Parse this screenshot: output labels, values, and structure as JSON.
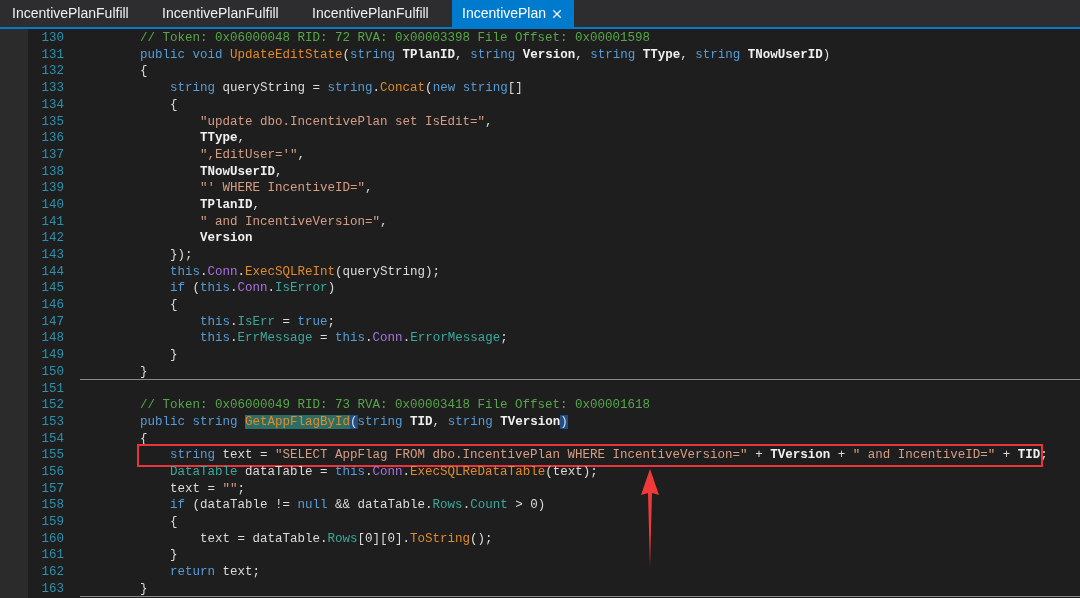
{
  "tabs": [
    {
      "label": "IncentivePlanFulfill",
      "selected": false
    },
    {
      "label": "IncentivePlanFulfill",
      "selected": false
    },
    {
      "label": "IncentivePlanFulfill",
      "selected": false
    },
    {
      "label": "IncentivePlan",
      "selected": true
    }
  ],
  "lines": [
    {
      "number": "130",
      "tokens": [
        {
          "kind": "comment",
          "text": "        // Token: 0x06000048 RID: 72 RVA: 0x00003398 File Offset: 0x00001598"
        }
      ]
    },
    {
      "number": "131",
      "tokens": [
        {
          "kind": "keyword",
          "text": "        public void "
        },
        {
          "kind": "method",
          "text": "UpdateEditState"
        },
        {
          "kind": "plain",
          "text": "("
        },
        {
          "kind": "keyword",
          "text": "string "
        },
        {
          "kind": "param",
          "text": "TPlanID"
        },
        {
          "kind": "plain",
          "text": ", "
        },
        {
          "kind": "keyword",
          "text": "string "
        },
        {
          "kind": "param",
          "text": "Version"
        },
        {
          "kind": "plain",
          "text": ", "
        },
        {
          "kind": "keyword",
          "text": "string "
        },
        {
          "kind": "param",
          "text": "TType"
        },
        {
          "kind": "plain",
          "text": ", "
        },
        {
          "kind": "keyword",
          "text": "string "
        },
        {
          "kind": "param",
          "text": "TNowUserID"
        },
        {
          "kind": "plain",
          "text": ")"
        }
      ]
    },
    {
      "number": "132",
      "tokens": [
        {
          "kind": "plain",
          "text": "        {"
        }
      ]
    },
    {
      "number": "133",
      "tokens": [
        {
          "kind": "keyword",
          "text": "            string "
        },
        {
          "kind": "plain",
          "text": "queryString = "
        },
        {
          "kind": "keyword",
          "text": "string"
        },
        {
          "kind": "plain",
          "text": "."
        },
        {
          "kind": "method",
          "text": "Concat"
        },
        {
          "kind": "plain",
          "text": "("
        },
        {
          "kind": "keyword",
          "text": "new string"
        },
        {
          "kind": "plain",
          "text": "[]"
        }
      ]
    },
    {
      "number": "134",
      "tokens": [
        {
          "kind": "plain",
          "text": "            {"
        }
      ]
    },
    {
      "number": "135",
      "tokens": [
        {
          "kind": "string",
          "text": "                \"update dbo.IncentivePlan set IsEdit=\""
        },
        {
          "kind": "plain",
          "text": ","
        }
      ]
    },
    {
      "number": "136",
      "tokens": [
        {
          "kind": "param",
          "text": "                TType"
        },
        {
          "kind": "plain",
          "text": ","
        }
      ]
    },
    {
      "number": "137",
      "tokens": [
        {
          "kind": "string",
          "text": "                \",EditUser='\""
        },
        {
          "kind": "plain",
          "text": ","
        }
      ]
    },
    {
      "number": "138",
      "tokens": [
        {
          "kind": "param",
          "text": "                TNowUserID"
        },
        {
          "kind": "plain",
          "text": ","
        }
      ]
    },
    {
      "number": "139",
      "tokens": [
        {
          "kind": "string",
          "text": "                \"' WHERE IncentiveID=\""
        },
        {
          "kind": "plain",
          "text": ","
        }
      ]
    },
    {
      "number": "140",
      "tokens": [
        {
          "kind": "param",
          "text": "                TPlanID"
        },
        {
          "kind": "plain",
          "text": ","
        }
      ]
    },
    {
      "number": "141",
      "tokens": [
        {
          "kind": "string",
          "text": "                \" and IncentiveVersion=\""
        },
        {
          "kind": "plain",
          "text": ","
        }
      ]
    },
    {
      "number": "142",
      "tokens": [
        {
          "kind": "param",
          "text": "                Version"
        }
      ]
    },
    {
      "number": "143",
      "tokens": [
        {
          "kind": "plain",
          "text": "            });"
        }
      ]
    },
    {
      "number": "144",
      "tokens": [
        {
          "kind": "keyword",
          "text": "            this"
        },
        {
          "kind": "plain",
          "text": "."
        },
        {
          "kind": "field",
          "text": "Conn"
        },
        {
          "kind": "plain",
          "text": "."
        },
        {
          "kind": "method",
          "text": "ExecSQLReInt"
        },
        {
          "kind": "plain",
          "text": "(queryString);"
        }
      ]
    },
    {
      "number": "145",
      "tokens": [
        {
          "kind": "keyword",
          "text": "            if "
        },
        {
          "kind": "plain",
          "text": "("
        },
        {
          "kind": "keyword",
          "text": "this"
        },
        {
          "kind": "plain",
          "text": "."
        },
        {
          "kind": "field",
          "text": "Conn"
        },
        {
          "kind": "plain",
          "text": "."
        },
        {
          "kind": "property",
          "text": "IsError"
        },
        {
          "kind": "plain",
          "text": ")"
        }
      ]
    },
    {
      "number": "146",
      "tokens": [
        {
          "kind": "plain",
          "text": "            {"
        }
      ]
    },
    {
      "number": "147",
      "tokens": [
        {
          "kind": "keyword",
          "text": "                this"
        },
        {
          "kind": "plain",
          "text": "."
        },
        {
          "kind": "property",
          "text": "IsErr"
        },
        {
          "kind": "plain",
          "text": " = "
        },
        {
          "kind": "keyword",
          "text": "true"
        },
        {
          "kind": "plain",
          "text": ";"
        }
      ]
    },
    {
      "number": "148",
      "tokens": [
        {
          "kind": "keyword",
          "text": "                this"
        },
        {
          "kind": "plain",
          "text": "."
        },
        {
          "kind": "property",
          "text": "ErrMessage"
        },
        {
          "kind": "plain",
          "text": " = "
        },
        {
          "kind": "keyword",
          "text": "this"
        },
        {
          "kind": "plain",
          "text": "."
        },
        {
          "kind": "field",
          "text": "Conn"
        },
        {
          "kind": "plain",
          "text": "."
        },
        {
          "kind": "property",
          "text": "ErrorMessage"
        },
        {
          "kind": "plain",
          "text": ";"
        }
      ]
    },
    {
      "number": "149",
      "tokens": [
        {
          "kind": "plain",
          "text": "            }"
        }
      ]
    },
    {
      "number": "150",
      "separator": true,
      "tokens": [
        {
          "kind": "plain",
          "text": "        }"
        }
      ]
    },
    {
      "number": "151"
    },
    {
      "number": "152",
      "tokens": [
        {
          "kind": "comment",
          "text": "        // Token: 0x06000049 RID: 73 RVA: 0x00003418 File Offset: 0x00001618"
        }
      ]
    },
    {
      "number": "153",
      "tokens": [
        {
          "kind": "keyword",
          "text": "        public string "
        },
        {
          "kind": "method",
          "text": "GetAppFlagById",
          "selected": true
        },
        {
          "kind": "plain",
          "text": "(",
          "brace_matched": true
        },
        {
          "kind": "keyword",
          "text": "string "
        },
        {
          "kind": "param",
          "text": "TID"
        },
        {
          "kind": "plain",
          "text": ", "
        },
        {
          "kind": "keyword",
          "text": "string "
        },
        {
          "kind": "param",
          "text": "TVersion"
        },
        {
          "kind": "plain",
          "text": ")",
          "brace_matched": true
        }
      ]
    },
    {
      "number": "154",
      "tokens": [
        {
          "kind": "plain",
          "text": "        {"
        }
      ]
    },
    {
      "number": "155",
      "boxed": true,
      "tokens": [
        {
          "kind": "keyword",
          "text": "            string "
        },
        {
          "kind": "plain",
          "text": "text = "
        },
        {
          "kind": "string",
          "text": "\"SELECT AppFlag FROM dbo.IncentivePlan WHERE IncentiveVersion=\""
        },
        {
          "kind": "plain",
          "text": " + "
        },
        {
          "kind": "param",
          "text": "TVersion"
        },
        {
          "kind": "plain",
          "text": " + "
        },
        {
          "kind": "string",
          "text": "\" and IncentiveID=\""
        },
        {
          "kind": "plain",
          "text": " + "
        },
        {
          "kind": "param",
          "text": "TID"
        },
        {
          "kind": "plain",
          "text": ";"
        }
      ]
    },
    {
      "number": "156",
      "tokens": [
        {
          "kind": "property",
          "text": "            DataTable "
        },
        {
          "kind": "plain",
          "text": "dataTable = "
        },
        {
          "kind": "keyword",
          "text": "this"
        },
        {
          "kind": "plain",
          "text": "."
        },
        {
          "kind": "field",
          "text": "Conn"
        },
        {
          "kind": "plain",
          "text": "."
        },
        {
          "kind": "method",
          "text": "ExecSQLReDataTable"
        },
        {
          "kind": "plain",
          "text": "(text);"
        }
      ]
    },
    {
      "number": "157",
      "tokens": [
        {
          "kind": "plain",
          "text": "            text = "
        },
        {
          "kind": "string",
          "text": "\"\""
        },
        {
          "kind": "plain",
          "text": ";"
        }
      ]
    },
    {
      "number": "158",
      "tokens": [
        {
          "kind": "keyword",
          "text": "            if "
        },
        {
          "kind": "plain",
          "text": "(dataTable != "
        },
        {
          "kind": "keyword",
          "text": "null"
        },
        {
          "kind": "plain",
          "text": " && dataTable."
        },
        {
          "kind": "property",
          "text": "Rows"
        },
        {
          "kind": "plain",
          "text": "."
        },
        {
          "kind": "property",
          "text": "Count"
        },
        {
          "kind": "plain",
          "text": " > 0)"
        }
      ]
    },
    {
      "number": "159",
      "tokens": [
        {
          "kind": "plain",
          "text": "            {"
        }
      ]
    },
    {
      "number": "160",
      "tokens": [
        {
          "kind": "plain",
          "text": "                text = dataTable."
        },
        {
          "kind": "property",
          "text": "Rows"
        },
        {
          "kind": "plain",
          "text": "[0][0]."
        },
        {
          "kind": "method",
          "text": "ToString"
        },
        {
          "kind": "plain",
          "text": "();"
        }
      ]
    },
    {
      "number": "161",
      "tokens": [
        {
          "kind": "plain",
          "text": "            }"
        }
      ]
    },
    {
      "number": "162",
      "tokens": [
        {
          "kind": "keyword",
          "text": "            return "
        },
        {
          "kind": "plain",
          "text": "text;"
        }
      ]
    },
    {
      "number": "163",
      "separator": true,
      "tokens": [
        {
          "kind": "plain",
          "text": "        }"
        }
      ]
    }
  ]
}
